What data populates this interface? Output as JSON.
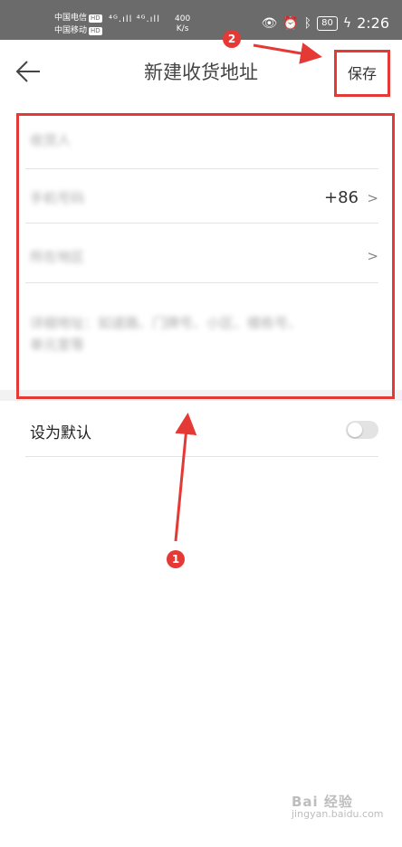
{
  "status_bar": {
    "carrier_1": "中国电信",
    "carrier_2": "中国移动",
    "hd_badge": "HD",
    "signal_text": "⁴ᴳ.ıll ⁴ᴳ.ıll",
    "net_speed_value": "400",
    "net_speed_unit": "K/s",
    "battery": "80",
    "time": "2:26"
  },
  "header": {
    "back_glyph": "←",
    "title": "新建收货地址",
    "save_label": "保存"
  },
  "form": {
    "recipient_placeholder": "收货人",
    "phone_placeholder": "手机号码",
    "country_code": "+86",
    "region_placeholder": "所在地区",
    "detail_placeholder_line1": "详细地址：如道路、门牌号、小区、楼栋号、",
    "detail_placeholder_line2": "单元室等",
    "chevron": ">"
  },
  "default_setting": {
    "label": "设为默认",
    "enabled": false
  },
  "annotations": {
    "badge_1": "1",
    "badge_2": "2",
    "color": "#e53935"
  },
  "watermark": {
    "main": "Bai 经验",
    "sub": "jingyan.baidu.com"
  }
}
